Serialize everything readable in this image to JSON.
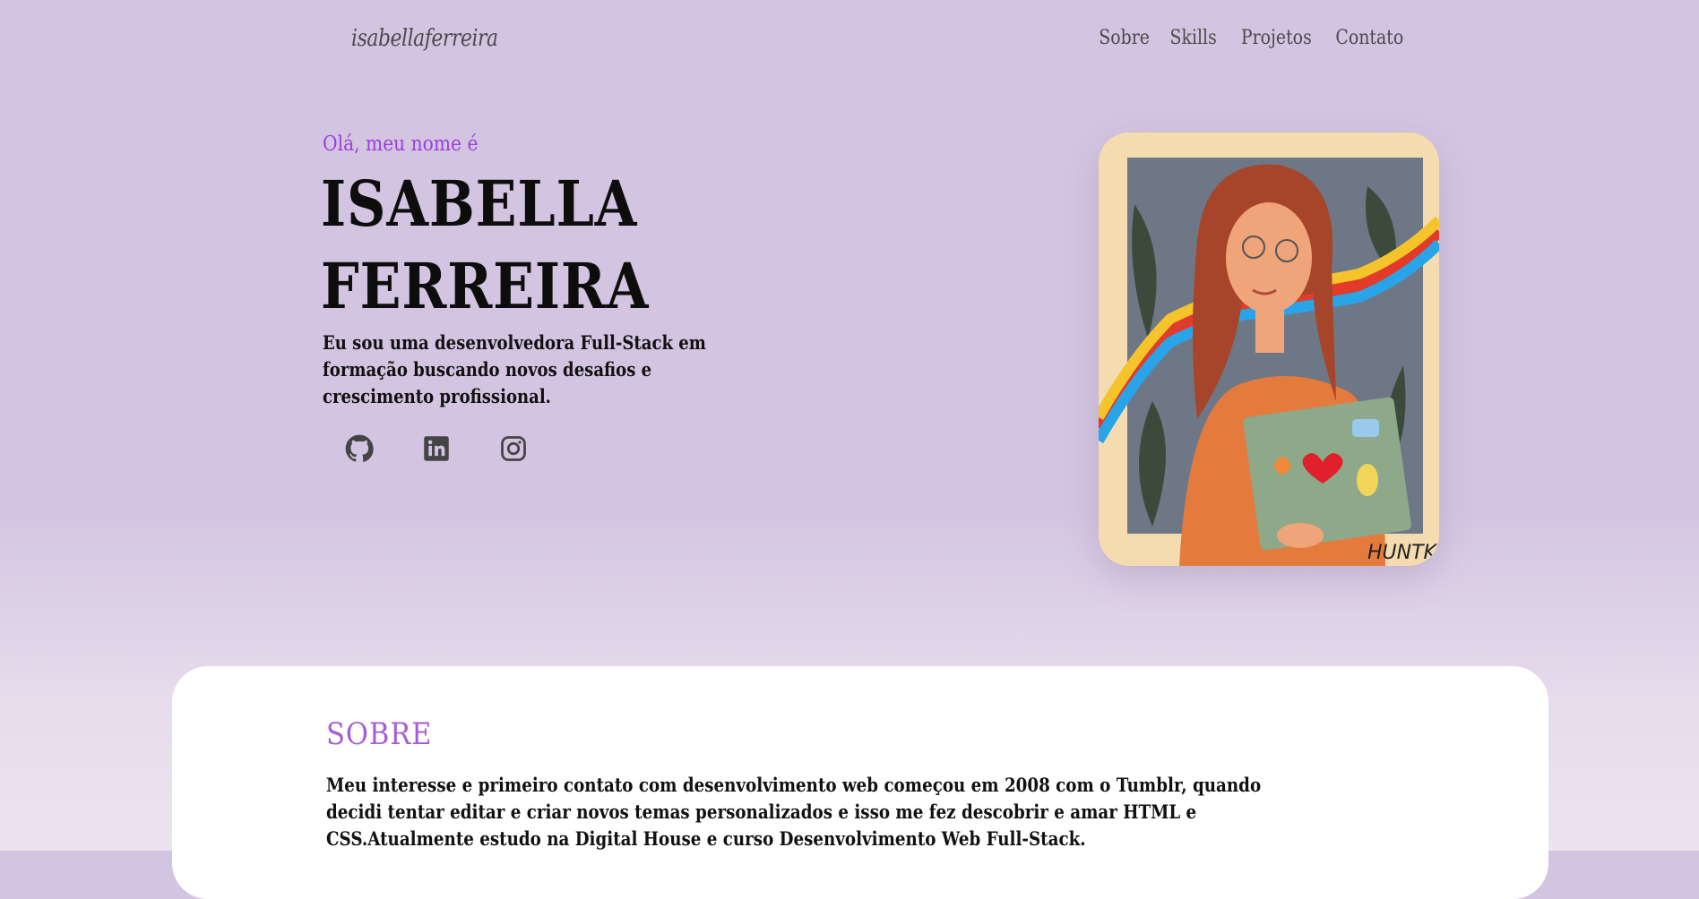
{
  "header": {
    "logo": "isabellaferreira",
    "nav": [
      "Sobre",
      "Skills",
      "Projetos",
      "Contato"
    ]
  },
  "hero": {
    "greeting": "Olá, meu nome é",
    "name_line1": "ISABELLA",
    "name_line2": "FERREIRA",
    "intro": "Eu sou uma desenvolvedora Full-Stack em formação buscando novos desafios e crescimento profissional.",
    "socials": [
      "github-icon",
      "linkedin-icon",
      "instagram-icon"
    ],
    "portrait_signature": "HUNTK"
  },
  "about": {
    "title": "SOBRE",
    "text": "Meu interesse e primeiro contato com desenvolvimento web começou em 2008 com o Tumblr, quando decidi tentar editar e criar novos temas personalizados e isso me fez descobrir e amar HTML e CSS.Atualmente estudo na Digital House e curso Desenvolvimento Web Full-Stack."
  },
  "colors": {
    "background": "#d3c5e1",
    "accent": "#9a3fe0",
    "section_title": "#a35fd4",
    "card": "#ffffff"
  }
}
